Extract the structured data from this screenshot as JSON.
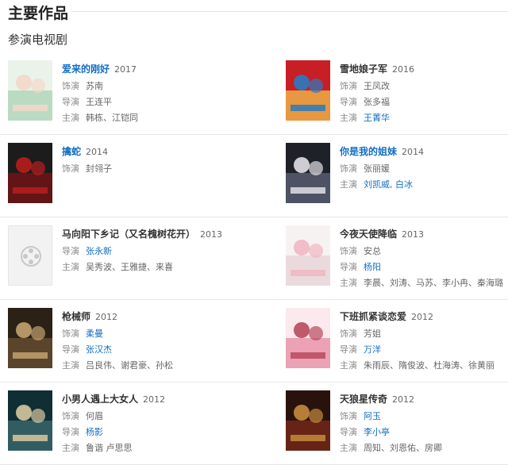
{
  "section_title": "主要作品",
  "sub_title": "参演电视剧",
  "works": [
    {
      "title": "爱来的刚好",
      "year": "2017",
      "title_link": true,
      "fields": [
        {
          "k": "饰演",
          "v": "苏南",
          "link": false
        },
        {
          "k": "导演",
          "v": "王连平",
          "link": false
        },
        {
          "k": "主演",
          "v": "韩栋、江铠同",
          "link": false
        }
      ],
      "poster": "light"
    },
    {
      "title": "雪地娘子军",
      "year": "2016",
      "title_link": false,
      "fields": [
        {
          "k": "饰演",
          "v": "王凤改",
          "link": false
        },
        {
          "k": "导演",
          "v": "张多福",
          "link": false
        },
        {
          "k": "主演",
          "v": "王菁华",
          "link": true
        }
      ],
      "poster": "red"
    },
    {
      "title": "擒蛇",
      "year": "2014",
      "title_link": true,
      "fields": [
        {
          "k": "饰演",
          "v": "封翎子",
          "link": false
        }
      ],
      "poster": "dark-red"
    },
    {
      "title": "你是我的姐妹",
      "year": "2014",
      "title_link": true,
      "fields": [
        {
          "k": "饰演",
          "v": "张丽媛",
          "link": false
        },
        {
          "k": "主演",
          "v": "刘凯威, 白冰",
          "link": true
        }
      ],
      "poster": "dark"
    },
    {
      "title": "马向阳下乡记（又名槐树花开）",
      "year": "2013",
      "title_link": false,
      "fields": [
        {
          "k": "导演",
          "v": "张永新",
          "link": true
        },
        {
          "k": "主演",
          "v": "吴秀波、王雅捷、来喜",
          "link": false
        }
      ],
      "poster": "none"
    },
    {
      "title": "今夜天使降临",
      "year": "2013",
      "title_link": false,
      "fields": [
        {
          "k": "饰演",
          "v": "安总",
          "link": false
        },
        {
          "k": "导演",
          "v": "杨阳",
          "link": true
        },
        {
          "k": "主演",
          "v": "李晨、刘涛、马苏、李小冉、秦海璐",
          "link": false
        }
      ],
      "poster": "white"
    },
    {
      "title": "枪械师",
      "year": "2012",
      "title_link": false,
      "fields": [
        {
          "k": "饰演",
          "v": "柔曼",
          "link": true
        },
        {
          "k": "导演",
          "v": "张汉杰",
          "link": true
        },
        {
          "k": "主演",
          "v": "吕良伟、谢君豪、孙松",
          "link": false
        }
      ],
      "poster": "sepia"
    },
    {
      "title": "下班抓紧谈恋爱",
      "year": "2012",
      "title_link": false,
      "fields": [
        {
          "k": "饰演",
          "v": "芳姐",
          "link": false
        },
        {
          "k": "导演",
          "v": "万洋",
          "link": true
        },
        {
          "k": "主演",
          "v": "朱雨辰、隋俊波、杜海涛、徐黄丽",
          "link": false
        }
      ],
      "poster": "pink"
    },
    {
      "title": "小男人遇上大女人",
      "year": "2012",
      "title_link": false,
      "fields": [
        {
          "k": "饰演",
          "v": "何眉",
          "link": false
        },
        {
          "k": "导演",
          "v": "杨影",
          "link": true
        },
        {
          "k": "主演",
          "v": "鲁谐 卢思思",
          "link": false
        }
      ],
      "poster": "teal"
    },
    {
      "title": "天狼星传奇",
      "year": "2012",
      "title_link": false,
      "fields": [
        {
          "k": "饰演",
          "v": "阿玉",
          "link": true
        },
        {
          "k": "导演",
          "v": "李小亭",
          "link": true
        },
        {
          "k": "主演",
          "v": "周知、刘恩佑、房卿",
          "link": false
        }
      ],
      "poster": "brown"
    }
  ]
}
